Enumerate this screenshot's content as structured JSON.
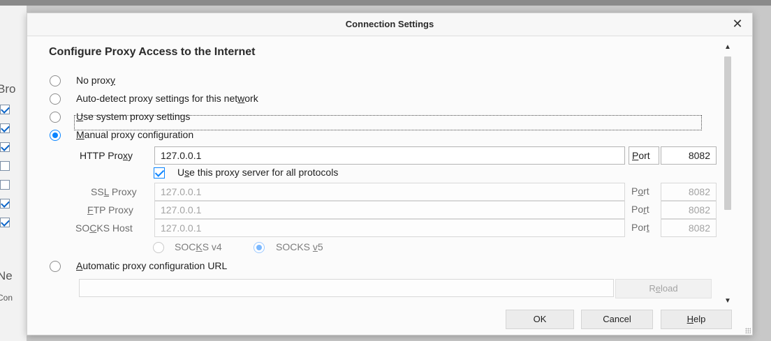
{
  "background": {
    "texts": [
      "Bro",
      "Ne",
      "Con"
    ],
    "checkboxes": [
      true,
      true,
      true,
      false,
      false,
      true,
      true
    ]
  },
  "dialog": {
    "title": "Connection Settings",
    "close_glyph": "✕",
    "heading": "Configure Proxy Access to the Internet",
    "options": {
      "no_proxy": {
        "pre": "No prox",
        "key": "y",
        "post": ""
      },
      "auto_detect": {
        "pre": "Auto-detect proxy settings for this net",
        "key": "w",
        "post": "ork"
      },
      "system": {
        "pre": "",
        "key": "U",
        "post": "se system proxy settings"
      },
      "manual": {
        "pre": "",
        "key": "M",
        "post": "anual proxy configuration"
      },
      "auto_url": {
        "pre": "",
        "key": "A",
        "post": "utomatic proxy configuration URL"
      }
    },
    "http": {
      "label_pre": "HTTP Pro",
      "label_key": "x",
      "label_post": "y",
      "value": "127.0.0.1",
      "port_key": "P",
      "port_post": "ort",
      "port": "8082"
    },
    "use_all": {
      "pre": "U",
      "key": "s",
      "post": "e this proxy server for all protocols"
    },
    "ssl": {
      "label_pre": "SS",
      "label_key": "L",
      "label_post": " Proxy",
      "value": "127.0.0.1",
      "port_pre": "P",
      "port_key": "o",
      "port_post": "rt",
      "port": "8082"
    },
    "ftp": {
      "label_pre": "",
      "label_key": "F",
      "label_post": "TP Proxy",
      "value": "127.0.0.1",
      "port_pre": "Po",
      "port_key": "r",
      "port_post": "t",
      "port": "8082"
    },
    "socks": {
      "label_pre": "SO",
      "label_key": "C",
      "label_post": "KS Host",
      "value": "127.0.0.1",
      "port_pre": "Por",
      "port_key": "t",
      "port_post": "",
      "port": "8082"
    },
    "socks_v4": {
      "pre": "SOC",
      "key": "K",
      "post": "S v4"
    },
    "socks_v5": {
      "pre": "SOCKS ",
      "key": "v",
      "post": "5"
    },
    "auto_url_value": "",
    "reload": {
      "pre": "R",
      "key": "e",
      "post": "load"
    },
    "buttons": {
      "ok": "OK",
      "cancel": "Cancel",
      "help_key": "H",
      "help_post": "elp"
    }
  },
  "colors": {
    "accent": "#0a84ff"
  }
}
